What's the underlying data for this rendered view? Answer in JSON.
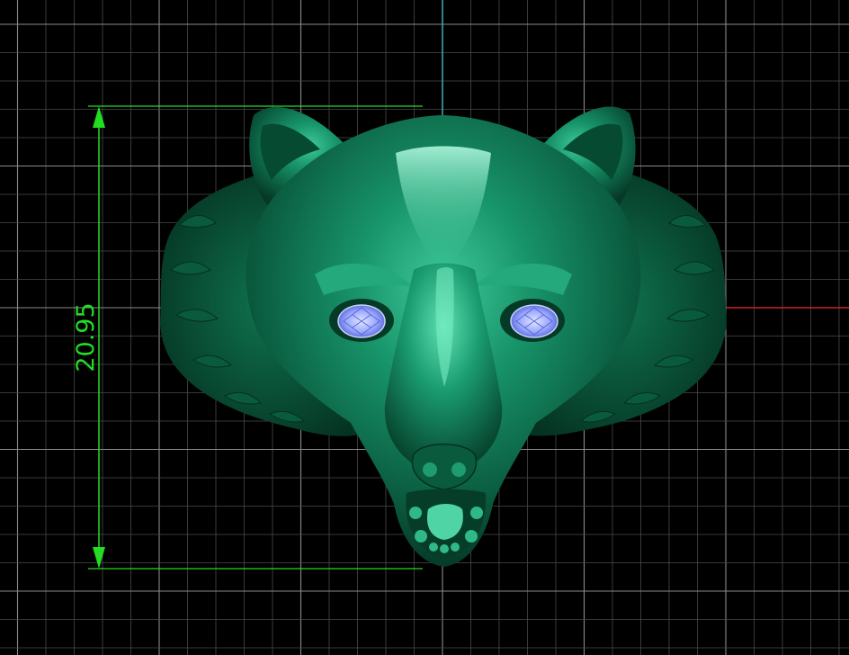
{
  "viewport": {
    "background": "#000000",
    "grid_minor_color": "#4a4a4a",
    "grid_major_color": "#8a8a8a",
    "axis_y_color": "#33aabb",
    "axis_x_color": "#cc2222"
  },
  "dimension": {
    "value": "20.95",
    "orientation": "vertical",
    "color": "#22dd22"
  },
  "model": {
    "subject": "wolf-head-ring",
    "body_color": "#0f7a55",
    "gem_color": "#9aa8ff"
  }
}
